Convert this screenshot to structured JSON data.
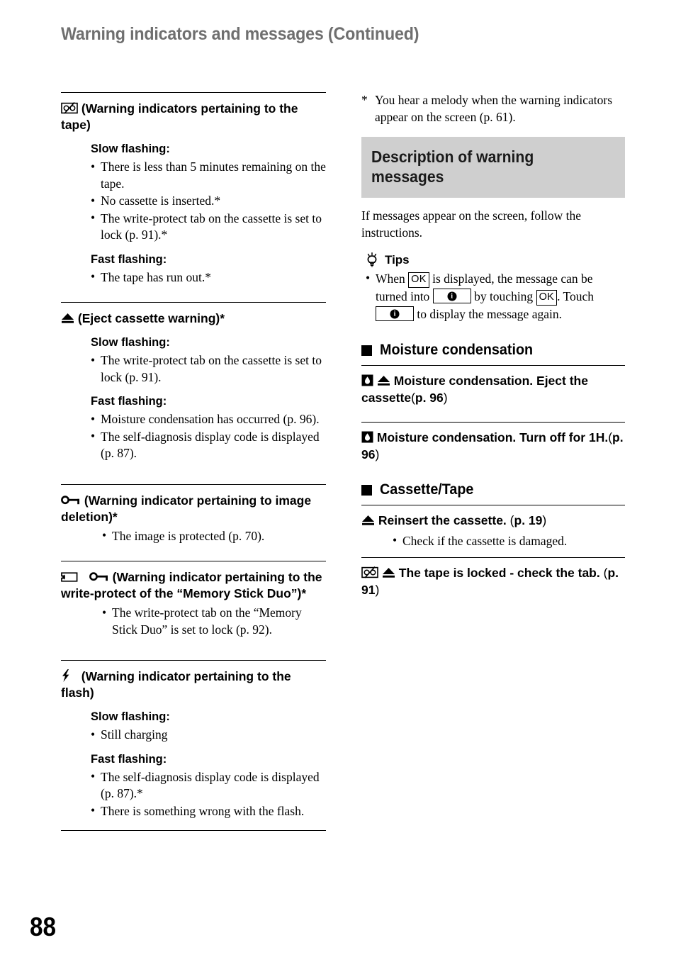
{
  "header": {
    "title": "Warning indicators and messages (Continued)"
  },
  "footer": {
    "page_number": "88"
  },
  "left_column": {
    "sections": [
      {
        "icon": "cassette-tape-slash-icon",
        "heading": "(Warning indicators pertaining to the tape)",
        "groups": [
          {
            "label": "Slow flashing:",
            "items": [
              "There is less than 5 minutes remaining on the tape.",
              "No cassette is inserted.*",
              "The write-protect tab on the cassette is set to lock (p. 91).*"
            ]
          },
          {
            "label": "Fast flashing:",
            "items": [
              "The tape has run out.*"
            ]
          }
        ]
      },
      {
        "icon": "eject-icon",
        "heading": "(Eject cassette warning)*",
        "groups": [
          {
            "label": "Slow flashing:",
            "items": [
              "The write-protect tab on the cassette is set to lock (p. 91)."
            ]
          },
          {
            "label": "Fast flashing:",
            "items": [
              "Moisture condensation has occurred (p. 96).",
              "The self-diagnosis display code is displayed (p. 87)."
            ]
          }
        ]
      },
      {
        "icon": "key-icon",
        "heading": "(Warning indicator pertaining to image deletion)*",
        "groups": [
          {
            "label": "",
            "items": [
              "The image is protected (p. 70)."
            ]
          }
        ]
      },
      {
        "icon": "memory-stick-key-icon",
        "heading": "(Warning indicator pertaining to the write-protect of the “Memory Stick Duo”)*",
        "groups": [
          {
            "label": "",
            "items": [
              "The write-protect tab on the “Memory Stick Duo” is set to lock (p. 92)."
            ]
          }
        ]
      },
      {
        "icon": "flash-bolt-icon",
        "heading": "(Warning indicator pertaining to the flash)",
        "groups": [
          {
            "label": "Slow flashing:",
            "items": [
              "Still charging"
            ]
          },
          {
            "label": "Fast flashing:",
            "items": [
              "The self-diagnosis display code is displayed (p. 87).*",
              "There is something wrong with the flash."
            ]
          }
        ]
      }
    ]
  },
  "right_column": {
    "footnote": {
      "marker": "*",
      "text": "You hear a melody when the warning indicators appear on the screen (p. 61)."
    },
    "banner": {
      "title": "Description of warning messages",
      "background": "#cfcfcf"
    },
    "intro": "If messages appear on the screen, follow the instructions.",
    "tips": {
      "icon": "lightbulb-icon",
      "label": "Tips",
      "item_part1": "When",
      "ok_label_1": "OK",
      "item_part2": "is displayed, the message can be turned into",
      "item_part3": "by touching",
      "ok_label_2": "OK",
      "item_part4": ". Touch",
      "item_part5": "to display the message again.",
      "info_glyph": "i"
    },
    "categories": [
      {
        "icon": "black-square-icon",
        "title": "Moisture condensation",
        "messages": [
          {
            "icons": [
              "moisture-drop-icon",
              "eject-icon"
            ],
            "text_bold": "Moisture condensation. Eject the cassette",
            "page_open": "(",
            "page_ref": "p. 96",
            "page_close": ")",
            "notes": []
          },
          {
            "icons": [
              "moisture-drop-icon"
            ],
            "text_bold": "Moisture condensation. Turn off for 1H.",
            "page_open": "(",
            "page_ref": "p. 96",
            "page_close": ")",
            "notes": []
          }
        ]
      },
      {
        "icon": "black-square-icon",
        "title": "Cassette/Tape",
        "messages": [
          {
            "icons": [
              "eject-icon"
            ],
            "text_bold": "Reinsert the cassette.",
            "page_open": "(",
            "page_ref": "p. 19",
            "page_close": ")",
            "notes": [
              "Check if the cassette is damaged."
            ]
          },
          {
            "icons": [
              "cassette-tape-slash-icon",
              "eject-icon"
            ],
            "text_bold": "The tape is locked - check the tab.",
            "page_open": "(",
            "page_ref": "p. 91",
            "page_close": ")",
            "notes": []
          }
        ]
      }
    ]
  }
}
